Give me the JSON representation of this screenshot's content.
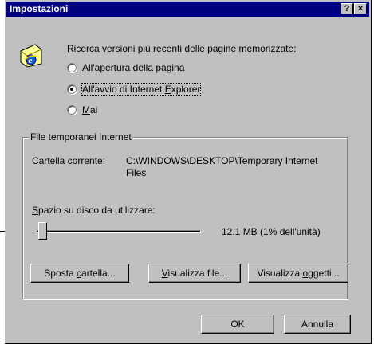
{
  "dialog": {
    "title": "Impostazioni",
    "help_glyph": "?",
    "close_glyph": "×",
    "icon": "ie-page-icon"
  },
  "check_updates": {
    "intro": "Ricerca versioni più recenti delle pagine memorizzate:",
    "options": [
      {
        "pre": "",
        "key": "A",
        "post": "ll'apertura della pagina",
        "checked": false
      },
      {
        "pre": "All'avvio di Internet ",
        "key": "E",
        "post": "xplorer",
        "checked": true
      },
      {
        "pre": "",
        "key": "M",
        "post": "ai",
        "checked": false
      }
    ]
  },
  "temp_files": {
    "group_title": "File temporanei Internet",
    "folder_label": "Cartella corrente:",
    "folder_value": "C:\\WINDOWS\\DESKTOP\\Temporary Internet Files",
    "disk_label_key": "S",
    "disk_label_rest": "pazio su disco da utilizzare:",
    "slider_fraction": 0.01,
    "slider_value": "12.1 MB (1% dell'unità)"
  },
  "buttons": {
    "move": {
      "pre": "Sposta ",
      "key": "c",
      "post": "artella..."
    },
    "view_files": {
      "pre": "",
      "key": "V",
      "post": "isualizza file..."
    },
    "view_objects": {
      "pre": "Visualizza ",
      "key": "o",
      "post": "ggetti..."
    },
    "ok": "OK",
    "cancel": "Annulla"
  }
}
